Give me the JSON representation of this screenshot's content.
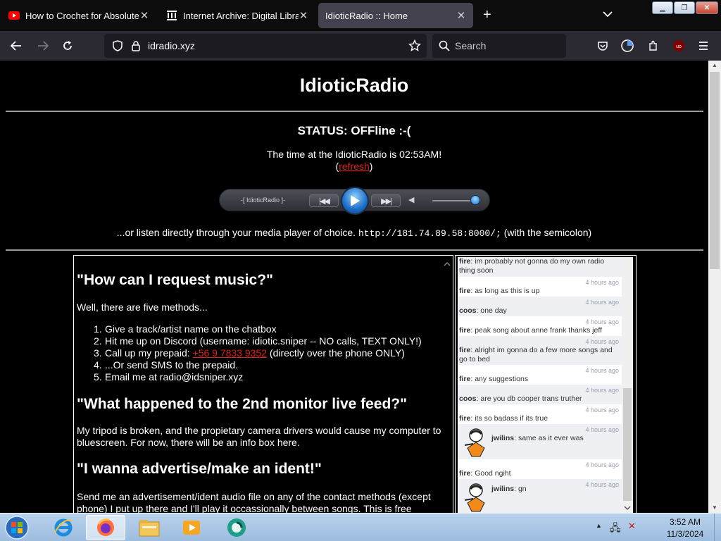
{
  "tabs": [
    {
      "title": "How to Crochet for Absolute Be",
      "favicon": "youtube-icon"
    },
    {
      "title": "Internet Archive: Digital Library",
      "favicon": "archive-icon"
    },
    {
      "title": "IdioticRadio :: Home",
      "favicon": "none",
      "active": true
    }
  ],
  "toolbar": {
    "url": "idradio.xyz",
    "search_placeholder": "Search"
  },
  "site": {
    "title": "IdioticRadio",
    "status": "STATUS: OFFline :-(",
    "time_prefix": "The time at the IdioticRadio is 02:53AM!",
    "refresh_open": "(",
    "refresh_link": "refresh",
    "refresh_close": ")",
    "player_label": "-[ IdioticRadio ]-",
    "listen_prefix": "...or listen directly through your media player of choice.",
    "listen_url": "http://181.74.89.58:8000/;",
    "listen_suffix": "(with the semicolon)"
  },
  "faq": {
    "q1": "\"How can I request music?\"",
    "q1_intro": "Well, there are five methods...",
    "methods": [
      {
        "num": "1.",
        "text": "Give a track/artist name on the chatbox"
      },
      {
        "num": "2.",
        "text": "Hit me up on Discord (username: idiotic.sniper -- NO calls, TEXT ONLY!)"
      },
      {
        "num": "3.",
        "text_before": "Call up my prepaid:",
        "link": "+56 9 7833 9352",
        "text_after": "(directly over the phone ONLY)"
      },
      {
        "num": "4.",
        "text": "...Or send SMS to the prepaid."
      },
      {
        "num": "5.",
        "text": "Email me at radio@idsniper.xyz"
      }
    ],
    "q2": "\"What happened to the 2nd monitor live feed?\"",
    "q2_answer_line1": "My tripod is broken, and the propietary camera drivers would cause my computer to",
    "q2_answer_line2": "bluescreen. For now, there will be an info box here.",
    "q3": "\"I wanna advertise/make an ident!\"",
    "q3_answer_line1": "Send me an advertisement/ident audio file on any of the contact methods (except",
    "q3_answer_line2": "phone) I put up there and I'll play it occassionally between songs. This is free"
  },
  "chat": [
    {
      "nick": "fire",
      "text": "im probably not gonna do my own radio thing soon",
      "ago": ""
    },
    {
      "nick": "fire",
      "text": "as long as this is up",
      "ago": "4 hours ago"
    },
    {
      "nick": "coos",
      "text": "one day",
      "ago": "4 hours ago"
    },
    {
      "nick": "fire",
      "text": "peak song about anne frank thanks jeff",
      "ago": "4 hours ago"
    },
    {
      "nick": "fire",
      "text": "alright im gonna do a few more songs and go to bed",
      "ago": "4 hours ago"
    },
    {
      "nick": "fire",
      "text": "any suggestions",
      "ago": "4 hours ago"
    },
    {
      "nick": "coos",
      "text": "are you db cooper trans truther",
      "ago": "4 hours ago"
    },
    {
      "nick": "fire",
      "text": "its so badass if its true",
      "ago": "4 hours ago"
    },
    {
      "nick": "jwilins",
      "text": "same as it ever was",
      "ago": "4 hours ago"
    },
    {
      "nick": "fire",
      "text": "Good ngiht",
      "ago": "4 hours ago"
    },
    {
      "nick": "jwilins",
      "text": "gn",
      "ago": "4 hours ago"
    }
  ],
  "taskbar": {
    "apps": [
      "internet-explorer-icon",
      "firefox-icon",
      "file-explorer-icon",
      "media-player-icon",
      "app-icon"
    ],
    "time": "3:52 AM",
    "date": "11/3/2024"
  },
  "colors": {
    "link_red": "#e0201a",
    "tab_active": "#42414d",
    "nav_bg": "#2b2a33"
  }
}
